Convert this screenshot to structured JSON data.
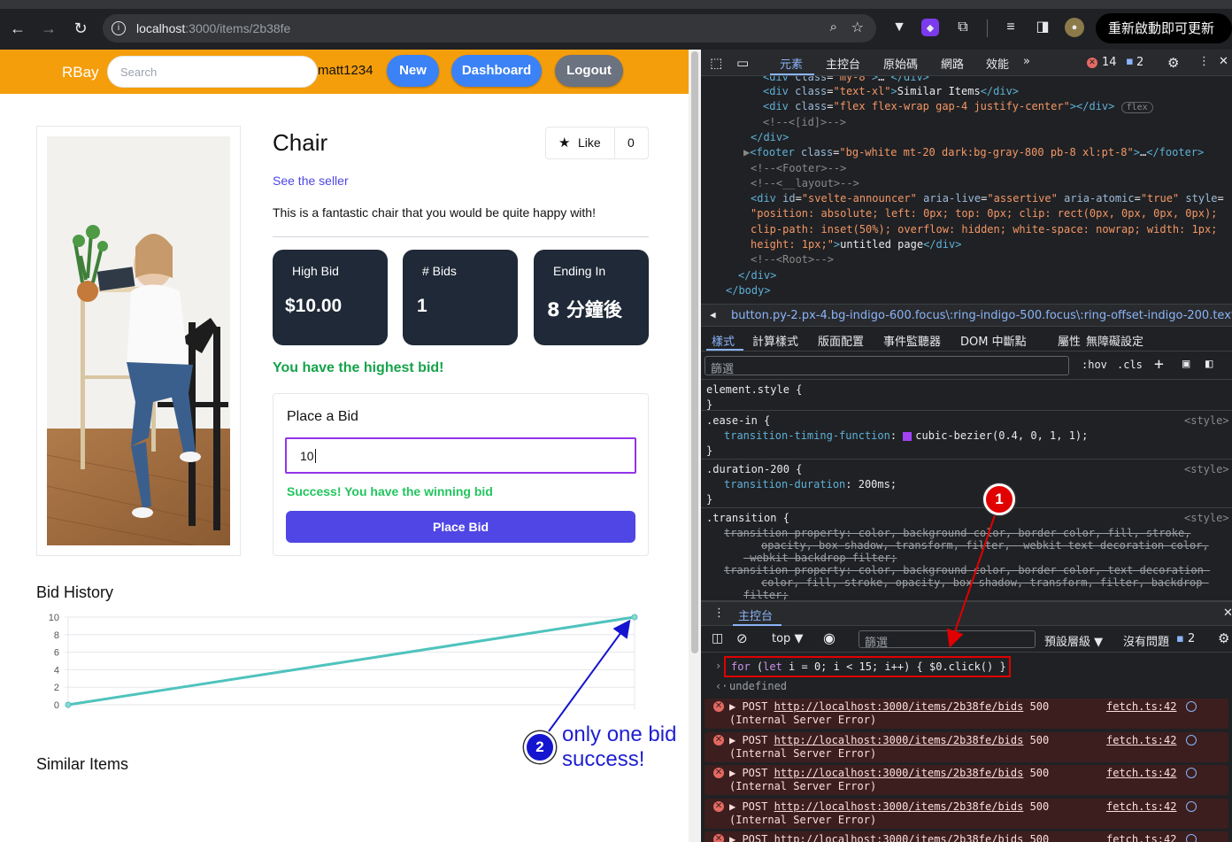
{
  "browser": {
    "url_host": "localhost",
    "url_path": ":3000/items/2b38fe",
    "update_button": "重新啟動即可更新"
  },
  "nav": {
    "brand": "RBay",
    "search_placeholder": "Search",
    "username": "matt1234",
    "new_label": "New",
    "dashboard_label": "Dashboard",
    "logout_label": "Logout"
  },
  "item": {
    "title": "Chair",
    "like_label": "Like",
    "like_count": "0",
    "see_seller": "See the seller",
    "description": "This is a fantastic chair that you would be quite happy with!",
    "stats": [
      {
        "label": "High Bid",
        "value": "$10.00"
      },
      {
        "label": "# Bids",
        "value": "1"
      },
      {
        "label": "Ending In",
        "value": "8 分鐘後"
      }
    ],
    "highest_msg": "You have the highest bid!"
  },
  "bid_form": {
    "title": "Place a Bid",
    "input_value": "10",
    "success_msg": "Success! You have the winning bid",
    "button_label": "Place Bid"
  },
  "bid_history_title": "Bid History",
  "similar_title": "Similar Items",
  "chart_data": {
    "type": "line",
    "x": [
      0,
      1
    ],
    "values": [
      0,
      10
    ],
    "ylim": [
      0,
      10
    ],
    "yticks": [
      "10",
      "8",
      "6",
      "4",
      "2",
      "0"
    ],
    "grid": true,
    "color": "#4fc3bd"
  },
  "devtools": {
    "tabs": [
      "元素",
      "主控台",
      "原始碼",
      "網路",
      "效能"
    ],
    "error_count": "14",
    "message_count": "2",
    "elements_lines": [
      {
        "html": "<span class='tg'>&lt;div</span> <span class='an'>class</span>=<span class='av'>\"my-8\"</span><span class='tg'>&gt;</span>… <span class='tg'>&lt;/div&gt;</span>"
      },
      {
        "html": "<span class='tg'>&lt;div</span> <span class='an'>class</span>=<span class='av'>\"text-xl\"</span><span class='tg'>&gt;</span><span class='tx'>Similar Items</span><span class='tg'>&lt;/div&gt;</span>"
      },
      {
        "html": "<span class='tg'>&lt;div</span> <span class='an'>class</span>=<span class='av'>\"flex flex-wrap gap-4 justify-center\"</span><span class='tg'>&gt;&lt;/div&gt;</span> <span class='cm' style='border:1px solid #5f6368;border-radius:8px;padding:0 5px;font-size:10px'>flex</span>"
      },
      {
        "html": "<span class='cm'>&lt;!--&lt;[id]&gt;--&gt;</span>"
      },
      {
        "html": "<span class='tg'>&lt;/div&gt;</span>"
      },
      {
        "html": "<span class='cm'>▶</span><span class='tg'>&lt;footer</span> <span class='an'>class</span>=<span class='av'>\"bg-white mt-20 dark:bg-gray-800 pb-8 xl:pt-8\"</span><span class='tg'>&gt;</span>…<span class='tg'>&lt;/footer&gt;</span>"
      },
      {
        "html": "<span class='cm'>&lt;!--&lt;Footer&gt;--&gt;</span>"
      },
      {
        "html": "<span class='cm'>&lt;!--&lt;__layout&gt;--&gt;</span>"
      },
      {
        "html": "<span class='tg'>&lt;div</span> <span class='an'>id</span>=<span class='av'>\"svelte-announcer\"</span> <span class='an'>aria-live</span>=<span class='av'>\"assertive\"</span> <span class='an'>aria-atomic</span>=<span class='av'>\"true\"</span> <span class='an'>style</span>="
      },
      {
        "html": "<span class='av'>\"position: absolute; left: 0px; top: 0px; clip: rect(0px, 0px, 0px, 0px);</span>"
      },
      {
        "html": "<span class='av'>clip-path: inset(50%); overflow: hidden; white-space: nowrap; width: 1px;</span>"
      },
      {
        "html": "<span class='av'>height: 1px;\"</span><span class='tg'>&gt;</span><span class='tx'>untitled page</span><span class='tg'>&lt;/div&gt;</span>"
      },
      {
        "html": "<span class='cm'>&lt;!--&lt;Root&gt;--&gt;</span>"
      },
      {
        "html": "<span class='tg'>&lt;/div&gt;</span>"
      },
      {
        "html": "<span class='tg'>&lt;/body&gt;</span>"
      }
    ],
    "breadcrumb": "button.py-2.px-4.bg-indigo-600.focus\\:ring-indigo-500.focus\\:ring-offset-indigo-200.text-white",
    "styles_tabs": [
      "樣式",
      "計算樣式",
      "版面配置",
      "事件監聽器",
      "DOM 中斷點",
      "屬性",
      "無障礙設定"
    ],
    "filter_placeholder": "篩選",
    "hov": ":hov",
    "cls": ".cls",
    "rules": [
      {
        "selector": "element.style {",
        "source": ""
      },
      {
        "selector": ".ease-in {",
        "source": "<style>",
        "prop": "transition-timing-function",
        "value": "cubic-bezier(0.4, 0, 1, 1);"
      },
      {
        "selector": ".duration-200 {",
        "source": "<style>",
        "prop": "transition-duration",
        "value": "200ms;"
      },
      {
        "selector": ".transition {",
        "source": "<style>"
      }
    ],
    "transition_lines": [
      "transition-property: color, background-color, border-color, fill, stroke,",
      "opacity, box-shadow, transform, filter, -webkit-text-decoration-color,",
      "-webkit-backdrop-filter;",
      "transition-property: color, background-color, border-color, text-decoration-",
      "color, fill, stroke, opacity, box-shadow, transform, filter, backdrop-",
      "filter;"
    ],
    "console_tab": "主控台",
    "context": "top",
    "console_filter": "篩選",
    "levels": "預設層級",
    "no_issues": "沒有問題",
    "issues_count": "2",
    "command": "for (let i = 0; i < 15; i++) { $0.click() }",
    "undefined": "undefined",
    "errors": [
      {
        "method": "▶ POST",
        "url": "http://localhost:3000/items/2b38fe/bids",
        "status": "500",
        "detail": "(Internal Server Error)",
        "file": "fetch.ts:42"
      },
      {
        "method": "▶ POST",
        "url": "http://localhost:3000/items/2b38fe/bids",
        "status": "500",
        "detail": "(Internal Server Error)",
        "file": "fetch.ts:42"
      },
      {
        "method": "▶ POST",
        "url": "http://localhost:3000/items/2b38fe/bids",
        "status": "500",
        "detail": "(Internal Server Error)",
        "file": "fetch.ts:42"
      },
      {
        "method": "▶ POST",
        "url": "http://localhost:3000/items/2b38fe/bids",
        "status": "500",
        "detail": "(Internal Server Error)",
        "file": "fetch.ts:42"
      },
      {
        "method": "▶ POST",
        "url": "http://localhost:3000/items/2b38fe/bids",
        "status": "500",
        "detail": "",
        "file": "fetch.ts:42"
      }
    ]
  },
  "annotations": {
    "badge1": "1",
    "badge2": "2",
    "note_line1": "only one bid",
    "note_line2": "success!",
    "red": "#e00000",
    "blue": "#1515d0"
  }
}
